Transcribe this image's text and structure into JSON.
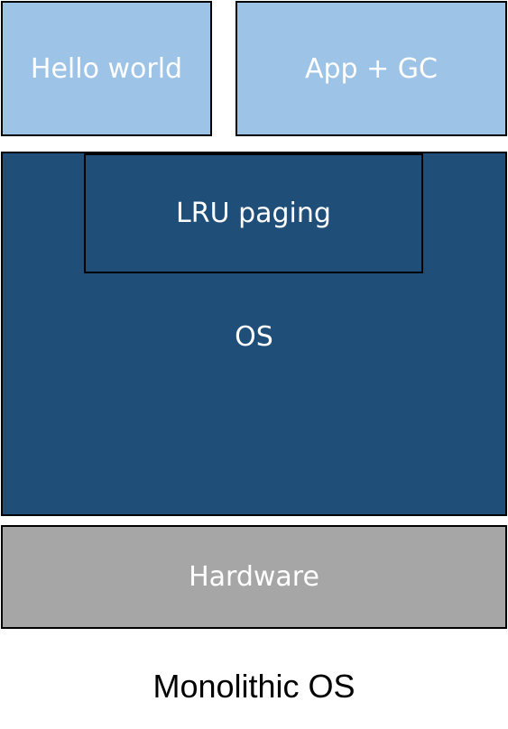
{
  "apps": {
    "hello_world": "Hello world",
    "app_gc": "App + GC"
  },
  "os": {
    "label": "OS",
    "lru_paging": "LRU paging"
  },
  "hardware": {
    "label": "Hardware"
  },
  "caption": "Monolithic OS",
  "colors": {
    "app_fill": "#9dc3e6",
    "os_fill": "#1f4e79",
    "hardware_fill": "#a6a6a6",
    "border": "#000000",
    "box_text": "#ffffff"
  }
}
